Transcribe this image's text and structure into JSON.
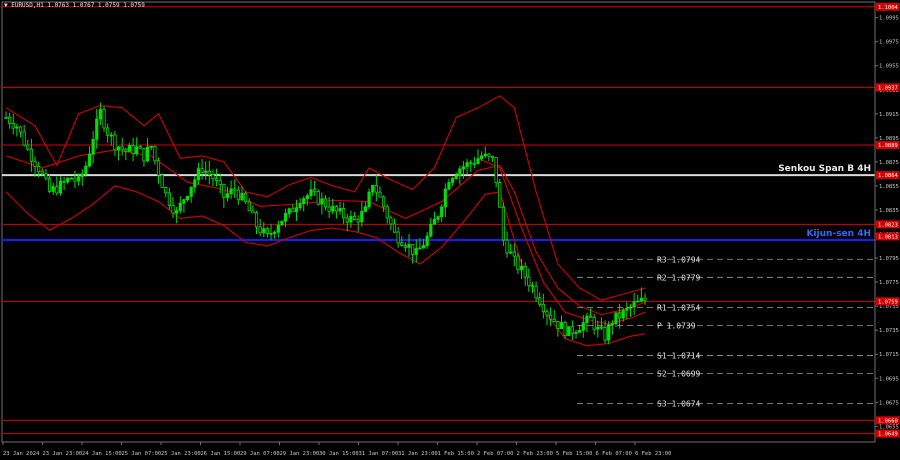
{
  "header": {
    "title": "▼ EURUSD,H1  1.0763 1.0767 1.0759 1.0759"
  },
  "colors": {
    "background": "#000000",
    "candle": "#00e000",
    "level": "#d40000",
    "senkou": "#d9d9d9",
    "kijun": "#1a1aff",
    "axis_text": "#c8c8c8",
    "price_tag": "#d40000"
  },
  "chart_data": {
    "type": "line",
    "symbol": "EURUSD",
    "timeframe": "H1",
    "ylim": [
      1.0642,
      1.1008
    ],
    "y_ticks": [
      "1.0995",
      "1.0975",
      "1.0955",
      "1.0935",
      "1.0915",
      "1.0895",
      "1.0875",
      "1.0855",
      "1.0835",
      "1.0815",
      "1.0795",
      "1.0775",
      "1.0755",
      "1.0735",
      "1.0715",
      "1.0695",
      "1.0675",
      "1.0655"
    ],
    "x_ticks": [
      "23 Jan 2024",
      "23 Jan 23:00",
      "24 Jan 15:00",
      "25 Jan 07:00",
      "25 Jan 23:00",
      "26 Jan 15:00",
      "29 Jan 07:00",
      "29 Jan 23:00",
      "30 Jan 15:00",
      "31 Jan 07:00",
      "31 Jan 23:00",
      "1 Feb 15:00",
      "2 Feb 07:00",
      "2 Feb 23:00",
      "5 Feb 15:00",
      "6 Feb 07:00",
      "6 Feb 23:00"
    ],
    "price_tags": [
      "1.1004",
      "1.0937",
      "1.0889",
      "1.0864",
      "1.0823",
      "1.0813",
      "1.0759",
      "1.0660",
      "1.0649"
    ],
    "horizontal_levels": [
      {
        "price": 1.1004,
        "kind": "level"
      },
      {
        "price": 1.0937,
        "kind": "level"
      },
      {
        "price": 1.0889,
        "kind": "level"
      },
      {
        "price": 1.0823,
        "kind": "level"
      },
      {
        "price": 1.0759,
        "kind": "level"
      },
      {
        "price": 1.066,
        "kind": "level"
      },
      {
        "price": 1.0649,
        "kind": "level"
      },
      {
        "price": 1.0864,
        "kind": "senkou",
        "label": "Senkou Span B 4H"
      },
      {
        "price": 1.081,
        "kind": "kijun",
        "label": "Kijun-sen 4H"
      }
    ],
    "pivots": [
      {
        "name": "R3",
        "value": "1.0794",
        "price": 1.0794
      },
      {
        "name": "R2",
        "value": "1.0779",
        "price": 1.0779
      },
      {
        "name": "R1",
        "value": "1.0754",
        "price": 1.0754
      },
      {
        "name": "P",
        "value": "1.0739",
        "price": 1.0739
      },
      {
        "name": "S1",
        "value": "1.0714",
        "price": 1.0714
      },
      {
        "name": "S2",
        "value": "1.0699",
        "price": 1.0699
      },
      {
        "name": "S3",
        "value": "1.0674",
        "price": 1.0674
      }
    ],
    "price_path": [
      [
        0,
        1.0912
      ],
      [
        3,
        1.0905
      ],
      [
        6,
        1.0885
      ],
      [
        9,
        1.087
      ],
      [
        12,
        1.085
      ],
      [
        15,
        1.0855
      ],
      [
        18,
        1.0862
      ],
      [
        20,
        1.0858
      ],
      [
        22,
        1.0872
      ],
      [
        24,
        1.0896
      ],
      [
        26,
        1.0916
      ],
      [
        28,
        1.09
      ],
      [
        30,
        1.089
      ],
      [
        33,
        1.0884
      ],
      [
        36,
        1.0886
      ],
      [
        38,
        1.088
      ],
      [
        40,
        1.0888
      ],
      [
        41,
        1.0876
      ],
      [
        44,
        1.0848
      ],
      [
        47,
        1.0832
      ],
      [
        49,
        1.0845
      ],
      [
        51,
        1.0856
      ],
      [
        54,
        1.087
      ],
      [
        57,
        1.0862
      ],
      [
        60,
        1.0846
      ],
      [
        63,
        1.0852
      ],
      [
        66,
        1.084
      ],
      [
        69,
        1.0822
      ],
      [
        72,
        1.0812
      ],
      [
        75,
        1.0825
      ],
      [
        78,
        1.0832
      ],
      [
        81,
        1.0845
      ],
      [
        84,
        1.0848
      ],
      [
        87,
        1.0842
      ],
      [
        90,
        1.0835
      ],
      [
        93,
        1.083
      ],
      [
        96,
        1.0826
      ],
      [
        99,
        1.0834
      ],
      [
        101,
        1.0858
      ],
      [
        104,
        1.0838
      ],
      [
        107,
        1.0815
      ],
      [
        110,
        1.0808
      ],
      [
        113,
        1.0798
      ],
      [
        116,
        1.0812
      ],
      [
        119,
        1.0832
      ],
      [
        122,
        1.0862
      ],
      [
        125,
        1.087
      ],
      [
        128,
        1.0874
      ],
      [
        131,
        1.088
      ],
      [
        134,
        1.0876
      ],
      [
        135,
        1.086
      ],
      [
        137,
        1.081
      ],
      [
        140,
        1.0792
      ],
      [
        143,
        1.078
      ],
      [
        146,
        1.0766
      ],
      [
        149,
        1.075
      ],
      [
        152,
        1.074
      ],
      [
        155,
        1.0733
      ],
      [
        158,
        1.0739
      ],
      [
        161,
        1.0744
      ],
      [
        163,
        1.0735
      ],
      [
        165,
        1.073
      ],
      [
        167,
        1.0743
      ],
      [
        170,
        1.0749
      ],
      [
        173,
        1.0756
      ],
      [
        176,
        1.076
      ]
    ],
    "indicator_bands": [
      {
        "name": "upper",
        "color": "red",
        "points": [
          [
            0,
            1.092
          ],
          [
            8,
            1.0905
          ],
          [
            14,
            1.0872
          ],
          [
            20,
            1.0915
          ],
          [
            26,
            1.0922
          ],
          [
            32,
            1.092
          ],
          [
            38,
            1.0905
          ],
          [
            42,
            1.0915
          ],
          [
            48,
            1.0878
          ],
          [
            54,
            1.088
          ],
          [
            60,
            1.0875
          ],
          [
            66,
            1.085
          ],
          [
            72,
            1.0846
          ],
          [
            78,
            1.0856
          ],
          [
            84,
            1.0862
          ],
          [
            90,
            1.0855
          ],
          [
            96,
            1.085
          ],
          [
            100,
            1.087
          ],
          [
            106,
            1.086
          ],
          [
            112,
            1.0852
          ],
          [
            118,
            1.087
          ],
          [
            124,
            1.0912
          ],
          [
            130,
            1.092
          ],
          [
            136,
            1.093
          ],
          [
            140,
            1.092
          ],
          [
            146,
            1.085
          ],
          [
            152,
            1.079
          ],
          [
            158,
            1.077
          ],
          [
            164,
            1.076
          ],
          [
            170,
            1.0765
          ],
          [
            176,
            1.077
          ]
        ]
      },
      {
        "name": "middle",
        "color": "red",
        "points": [
          [
            0,
            1.088
          ],
          [
            10,
            1.087
          ],
          [
            20,
            1.088
          ],
          [
            30,
            1.0885
          ],
          [
            40,
            1.088
          ],
          [
            50,
            1.0858
          ],
          [
            60,
            1.0852
          ],
          [
            70,
            1.0838
          ],
          [
            80,
            1.084
          ],
          [
            90,
            1.0843
          ],
          [
            100,
            1.0842
          ],
          [
            110,
            1.0828
          ],
          [
            120,
            1.0842
          ],
          [
            130,
            1.0868
          ],
          [
            136,
            1.0872
          ],
          [
            140,
            1.085
          ],
          [
            146,
            1.08
          ],
          [
            152,
            1.077
          ],
          [
            158,
            1.0755
          ],
          [
            164,
            1.0748
          ],
          [
            170,
            1.0752
          ],
          [
            176,
            1.0758
          ]
        ]
      },
      {
        "name": "lower",
        "color": "red",
        "points": [
          [
            0,
            1.085
          ],
          [
            6,
            1.0832
          ],
          [
            12,
            1.0818
          ],
          [
            18,
            1.0828
          ],
          [
            24,
            1.084
          ],
          [
            30,
            1.0855
          ],
          [
            36,
            1.085
          ],
          [
            42,
            1.0842
          ],
          [
            48,
            1.0828
          ],
          [
            54,
            1.083
          ],
          [
            60,
            1.0822
          ],
          [
            66,
            1.0808
          ],
          [
            72,
            1.0805
          ],
          [
            78,
            1.0812
          ],
          [
            84,
            1.0818
          ],
          [
            90,
            1.082
          ],
          [
            96,
            1.0817
          ],
          [
            102,
            1.0812
          ],
          [
            108,
            1.08
          ],
          [
            114,
            1.079
          ],
          [
            120,
            1.0804
          ],
          [
            126,
            1.0825
          ],
          [
            132,
            1.0848
          ],
          [
            136,
            1.085
          ],
          [
            142,
            1.079
          ],
          [
            148,
            1.0752
          ],
          [
            154,
            1.0728
          ],
          [
            160,
            1.0722
          ],
          [
            166,
            1.0724
          ],
          [
            172,
            1.073
          ],
          [
            176,
            1.0732
          ]
        ]
      },
      {
        "name": "conversion",
        "color": "red",
        "points": [
          [
            130,
            1.0878
          ],
          [
            136,
            1.087
          ],
          [
            142,
            1.082
          ],
          [
            148,
            1.0775
          ],
          [
            154,
            1.075
          ],
          [
            160,
            1.0744
          ],
          [
            166,
            1.074
          ],
          [
            172,
            1.0745
          ],
          [
            176,
            1.075
          ]
        ]
      }
    ]
  }
}
